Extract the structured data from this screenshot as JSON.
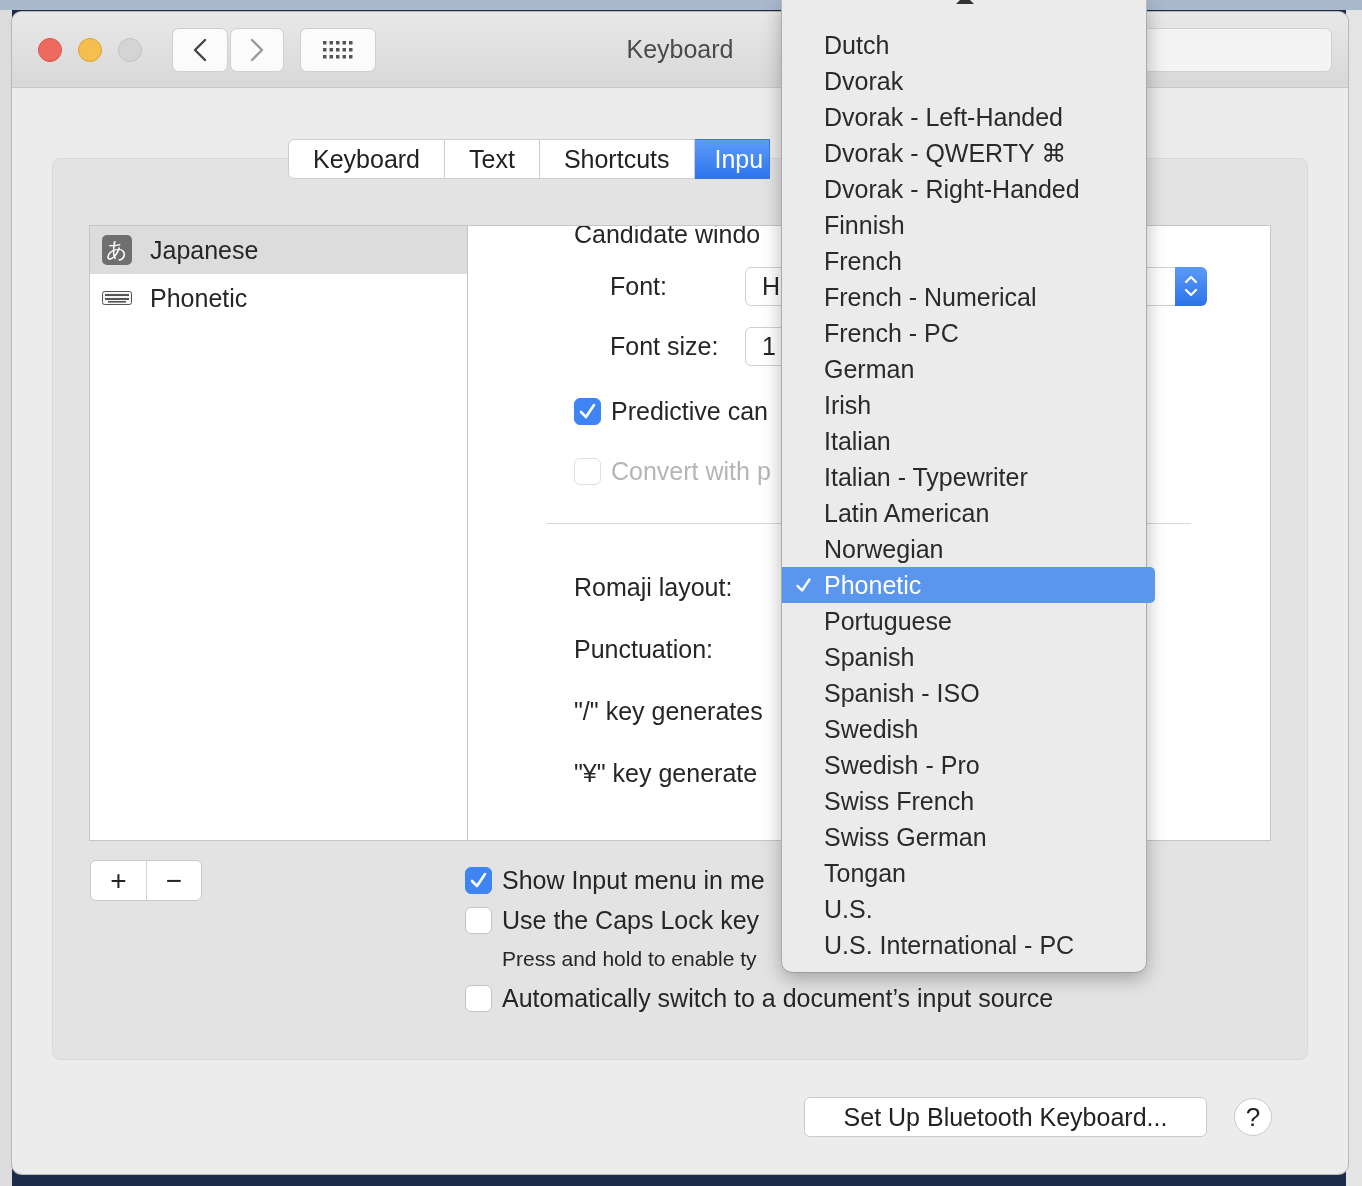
{
  "window": {
    "title": "Keyboard"
  },
  "tabs": [
    {
      "label": "Keyboard",
      "selected": false
    },
    {
      "label": "Text",
      "selected": false
    },
    {
      "label": "Shortcuts",
      "selected": false
    },
    {
      "label": "Inpu",
      "selected": true
    }
  ],
  "input_sources": [
    {
      "kind": "badge",
      "badge": "あ",
      "label": "Japanese",
      "selected": true
    },
    {
      "kind": "keyboard",
      "label": "Phonetic",
      "selected": false
    }
  ],
  "detail": {
    "section_title": "Candidate windo",
    "font": {
      "label": "Font:",
      "value": "H"
    },
    "font_size": {
      "label": "Font size:",
      "value": "1"
    },
    "options": [
      {
        "label": "Predictive can",
        "checked": true,
        "disabled": false
      },
      {
        "label": "Convert with p",
        "checked": false,
        "disabled": true
      }
    ],
    "settings": [
      "Romaji layout:",
      "Punctuation:",
      "\"/\" key generates",
      "\"¥\" key generate"
    ]
  },
  "list_buttons": [
    "+",
    "−"
  ],
  "options": [
    {
      "kind": "checkbox",
      "label": "Show Input menu in me",
      "checked": true
    },
    {
      "kind": "checkbox",
      "label": "Use the Caps Lock key",
      "checked": false
    },
    {
      "kind": "note",
      "label": "Press and hold to enable ty"
    },
    {
      "kind": "checkbox",
      "label": "Automatically switch to a document’s input source",
      "checked": false
    }
  ],
  "buttons": {
    "bluetooth": "Set Up Bluetooth Keyboard...",
    "help": "?"
  },
  "menu": {
    "items": [
      {
        "label": "Dutch",
        "selected": false
      },
      {
        "label": "Dvorak",
        "selected": false
      },
      {
        "label": "Dvorak - Left-Handed",
        "selected": false
      },
      {
        "label": "Dvorak - QWERTY ⌘",
        "selected": false
      },
      {
        "label": "Dvorak - Right-Handed",
        "selected": false
      },
      {
        "label": "Finnish",
        "selected": false
      },
      {
        "label": "French",
        "selected": false
      },
      {
        "label": "French - Numerical",
        "selected": false
      },
      {
        "label": "French - PC",
        "selected": false
      },
      {
        "label": "German",
        "selected": false
      },
      {
        "label": "Irish",
        "selected": false
      },
      {
        "label": "Italian",
        "selected": false
      },
      {
        "label": "Italian - Typewriter",
        "selected": false
      },
      {
        "label": "Latin American",
        "selected": false
      },
      {
        "label": "Norwegian",
        "selected": false
      },
      {
        "label": "Phonetic",
        "selected": true
      },
      {
        "label": "Portuguese",
        "selected": false
      },
      {
        "label": "Spanish",
        "selected": false
      },
      {
        "label": "Spanish - ISO",
        "selected": false
      },
      {
        "label": "Swedish",
        "selected": false
      },
      {
        "label": "Swedish - Pro",
        "selected": false
      },
      {
        "label": "Swiss French",
        "selected": false
      },
      {
        "label": "Swiss German",
        "selected": false
      },
      {
        "label": "Tongan",
        "selected": false
      },
      {
        "label": "U.S.",
        "selected": false
      },
      {
        "label": "U.S. International - PC",
        "selected": false
      }
    ]
  }
}
